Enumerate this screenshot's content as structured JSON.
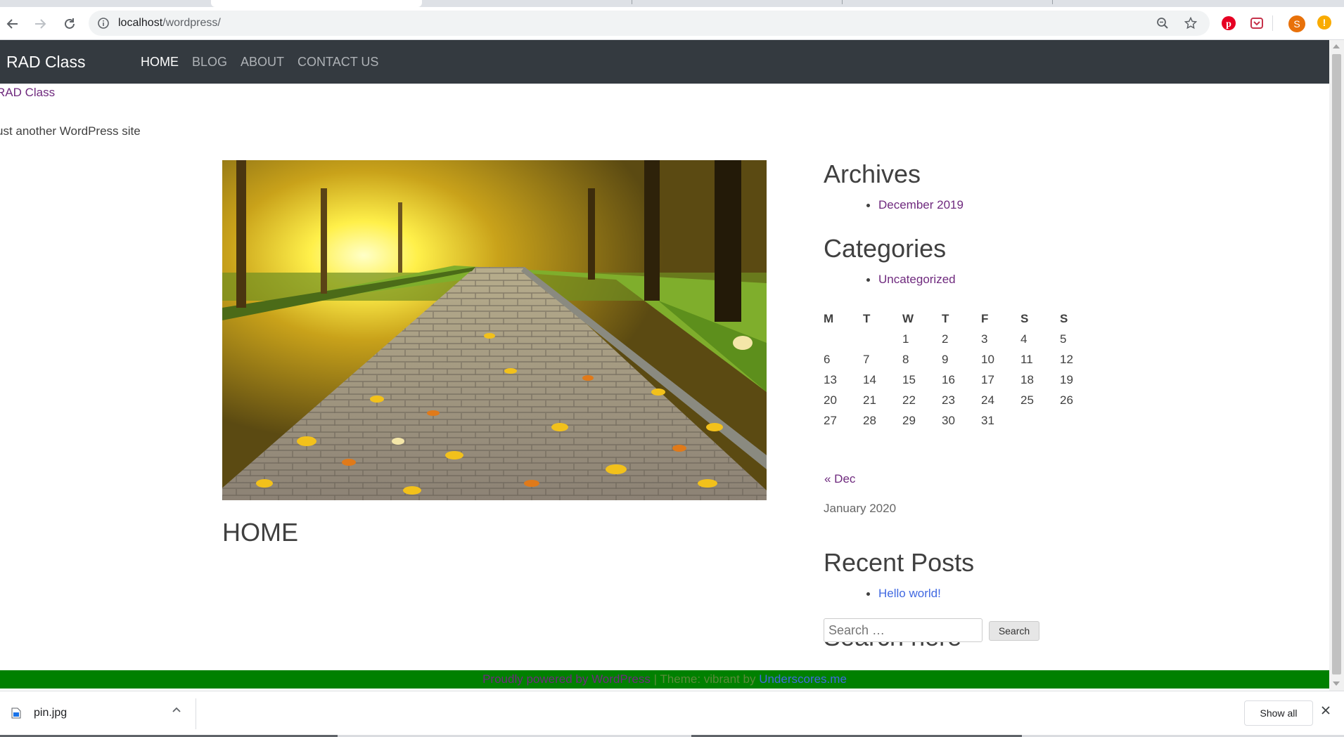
{
  "browser": {
    "url_host": "localhost",
    "url_path": "/wordpress/",
    "downloads": {
      "file_name": "pin.jpg",
      "show_all_label": "Show all"
    },
    "profile_initial": "S",
    "alert_badge": "!"
  },
  "site": {
    "brand": "RAD Class",
    "menu": [
      {
        "label": "HOME",
        "active": true
      },
      {
        "label": "BLOG",
        "active": false
      },
      {
        "label": "ABOUT",
        "active": false
      },
      {
        "label": "CONTACT US",
        "active": false
      }
    ],
    "title": "RAD Class",
    "description": "ust another WordPress site"
  },
  "main": {
    "heading": "HOME",
    "hero_image": "autumn-park-path"
  },
  "sidebar": {
    "archives": {
      "title": "Archives",
      "items": [
        "December 2019"
      ]
    },
    "categories": {
      "title": "Categories",
      "items": [
        "Uncategorized"
      ]
    },
    "calendar": {
      "headers": [
        "M",
        "T",
        "W",
        "T",
        "F",
        "S",
        "S"
      ],
      "rows": [
        [
          "",
          "",
          "1",
          "2",
          "3",
          "4",
          "5"
        ],
        [
          "6",
          "7",
          "8",
          "9",
          "10",
          "11",
          "12"
        ],
        [
          "13",
          "14",
          "15",
          "16",
          "17",
          "18",
          "19"
        ],
        [
          "20",
          "21",
          "22",
          "23",
          "24",
          "25",
          "26"
        ],
        [
          "27",
          "28",
          "29",
          "30",
          "31",
          "",
          ""
        ]
      ],
      "prev_link": "« Dec",
      "caption": "January 2020"
    },
    "recent_posts": {
      "title": "Recent Posts",
      "items": [
        "Hello world!"
      ]
    },
    "search": {
      "title": "Search here",
      "placeholder": "Search …",
      "button": "Search"
    }
  },
  "footer": {
    "powered": "Proudly powered by WordPress",
    "separator": " | ",
    "theme_text": "Theme: vibrant by ",
    "theme_author": "Underscores.me"
  }
}
